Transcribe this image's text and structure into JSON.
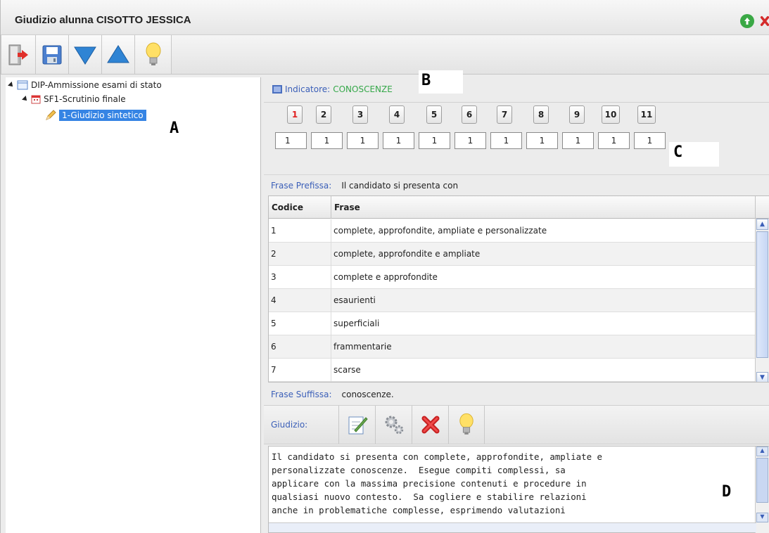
{
  "window": {
    "title": "Giudizio alunna CISOTTO JESSICA"
  },
  "toolbar": {
    "buttons": [
      "exit-icon",
      "save-icon",
      "arrow-down-icon",
      "arrow-up-icon",
      "lightbulb-icon"
    ]
  },
  "tree": {
    "root": "DIP-Ammissione esami di stato",
    "child": "SF1-Scrutinio finale",
    "leaf": "1-Giudizio sintetico"
  },
  "annotations": {
    "a": "A",
    "b": "B",
    "c": "C",
    "d": "D"
  },
  "indicator": {
    "label": "Indicatore:",
    "value": "CONOSCENZE"
  },
  "levels": {
    "buttons": [
      "1",
      "2",
      "3",
      "4",
      "5",
      "6",
      "7",
      "8",
      "9",
      "10",
      "11"
    ],
    "values": [
      "1",
      "1",
      "1",
      "1",
      "1",
      "1",
      "1",
      "1",
      "1",
      "1",
      "1"
    ]
  },
  "prefix": {
    "label": "Frase Prefissa:",
    "text": "Il candidato si presenta con"
  },
  "table": {
    "headers": [
      "Codice",
      "Frase"
    ],
    "rows": [
      {
        "code": "1",
        "phrase": "complete, approfondite, ampliate e personalizzate"
      },
      {
        "code": "2",
        "phrase": "complete, approfondite e ampliate"
      },
      {
        "code": "3",
        "phrase": "complete e approfondite"
      },
      {
        "code": "4",
        "phrase": "esaurienti"
      },
      {
        "code": "5",
        "phrase": "superficiali"
      },
      {
        "code": "6",
        "phrase": "frammentarie"
      },
      {
        "code": "7",
        "phrase": "scarse"
      }
    ]
  },
  "suffix": {
    "label": "Frase Suffissa:",
    "text": "conoscenze."
  },
  "giudizio": {
    "label": "Giudizio:",
    "text": "Il candidato si presenta con complete, approfondite, ampliate e\npersonalizzate conoscenze.  Esegue compiti complessi, sa\napplicare con la massima precisione contenuti e procedure in\nqualsiasi nuovo contesto.  Sa cogliere e stabilire relazioni\nanche in problematiche complesse, esprimendo valutazioni"
  },
  "colors": {
    "accent_blue": "#3b5fb8",
    "indicator_green": "#36a84a",
    "active_red": "#e02020",
    "selection": "#3584e4"
  }
}
